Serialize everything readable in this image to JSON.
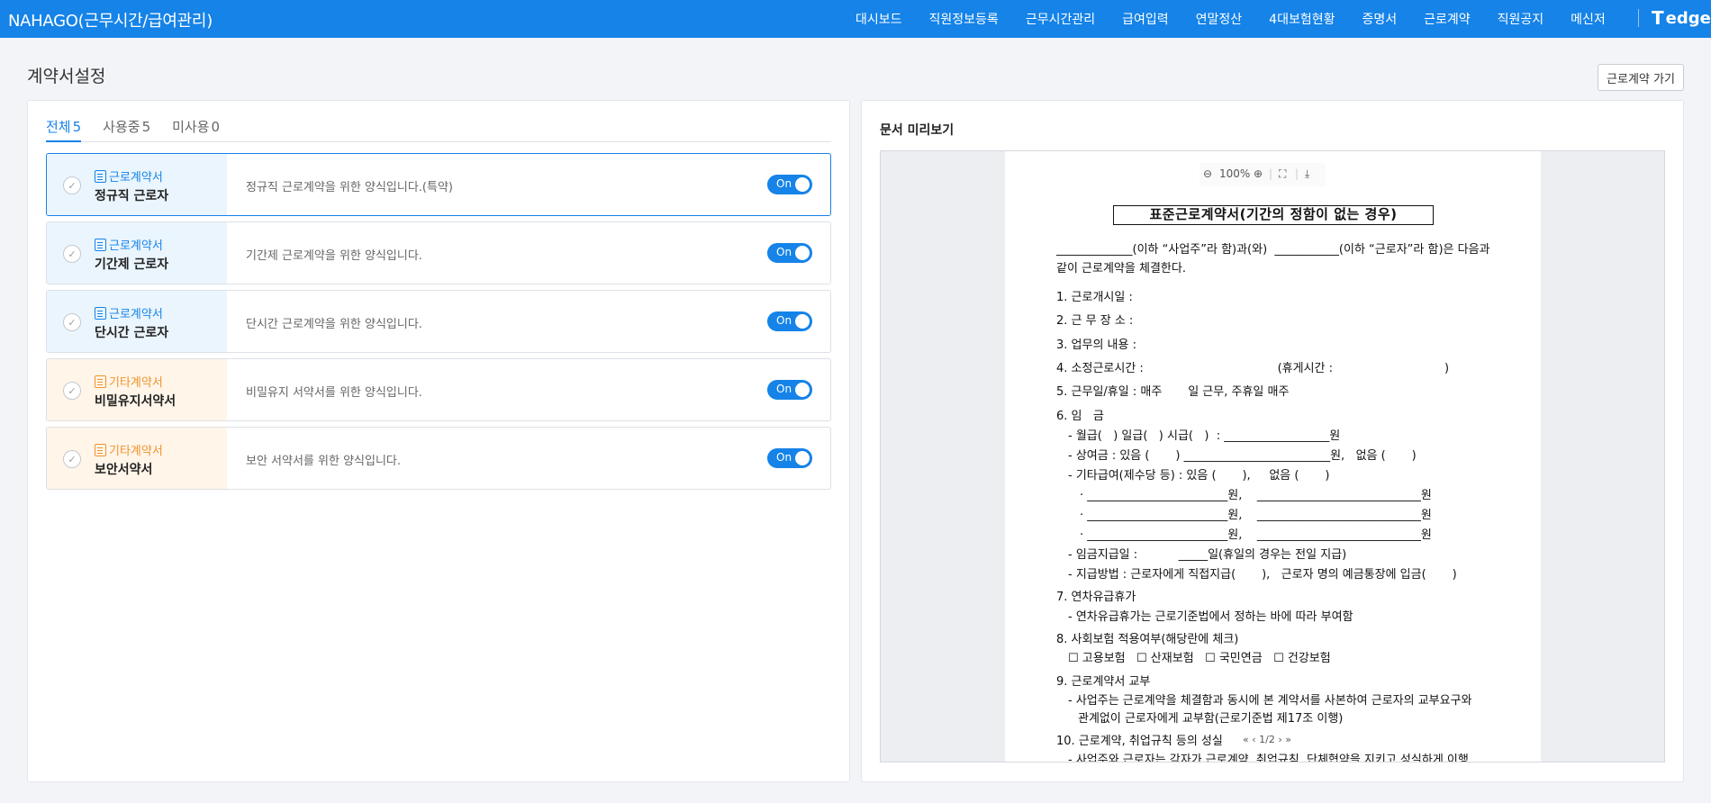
{
  "app": {
    "title": "NAHAGO(근무시간/급여관리)",
    "nav": [
      "대시보드",
      "직원정보등록",
      "근무시간관리",
      "급여입력",
      "연말정산",
      "4대보험현황",
      "증명서",
      "근로계약",
      "직원공지",
      "메신저"
    ],
    "logo_mark": "T",
    "logo_text": "edge"
  },
  "page": {
    "title": "계약서설정",
    "goto_button": "근로계약 가기"
  },
  "tabs": [
    {
      "label": "전체",
      "count": "5",
      "active": true
    },
    {
      "label": "사용중",
      "count": "5",
      "active": false
    },
    {
      "label": "미사용",
      "count": "0",
      "active": false
    }
  ],
  "templates": [
    {
      "category": "근로계약서",
      "name": "정규직 근로자",
      "desc": "정규직 근로계약을 위한 양식입니다.(특약)",
      "toggle": "On",
      "selected": true,
      "accent": "blue"
    },
    {
      "category": "근로계약서",
      "name": "기간제 근로자",
      "desc": "기간제 근로계약을 위한 양식입니다.",
      "toggle": "On",
      "selected": false,
      "accent": "blue"
    },
    {
      "category": "근로계약서",
      "name": "단시간 근로자",
      "desc": "단시간 근로계약을 위한 양식입니다.",
      "toggle": "On",
      "selected": false,
      "accent": "blue"
    },
    {
      "category": "기타계약서",
      "name": "비밀유지서약서",
      "desc": "비밀유지 서약서를 위한 양식입니다.",
      "toggle": "On",
      "selected": false,
      "accent": "orange"
    },
    {
      "category": "기타계약서",
      "name": "보안서약서",
      "desc": "보안 서약서를 위한 양식입니다.",
      "toggle": "On",
      "selected": false,
      "accent": "orange"
    }
  ],
  "colors": {
    "primary": "#1583e8",
    "orange": "#f0932b"
  },
  "preview": {
    "title": "문서 미리보기",
    "zoom": "100%",
    "page_indicator": "1/2",
    "doc_title": "표준근로계약서(기간의 정함이 없는 경우)",
    "lines": [
      "_____________(이하 “사업주”라 함)과(와)  ___________(이하 “근로자”라 함)은 다음과",
      "같이 근로계약을 체결한다.",
      "1. 근로개시일 :",
      "2. 근 무 장 소 :",
      "3. 업무의 내용 :",
      "4. 소정근로시간 :                                    (휴게시간 :                              )",
      "5. 근무일/휴일 : 매주       일 근무, 주휴일 매주",
      "6. 임   금",
      "- 월급(   ) 일급(   ) 시급(   )  : __________________원",
      "- 상여금 : 있음 (       ) _________________________원,   없음 (       )",
      "- 기타급여(제수당 등) : 있음 (       ),     없음 (       )",
      "· ________________________원,    ____________________________원",
      "· ________________________원,    ____________________________원",
      "· ________________________원,    ____________________________원",
      "- 임금지급일 :           _____일(휴일의 경우는 전일 지급)",
      "- 지급방법 : 근로자에게 직접지급(       ),   근로자 명의 예금통장에 입금(       )",
      "7. 연차유급휴가",
      "- 연차유급휴가는 근로기준법에서 정하는 바에 따라 부여함",
      "8. 사회보험 적용여부(해당란에 체크)",
      "☐ 고용보험   ☐ 산재보험   ☐ 국민연금   ☐ 건강보험",
      "9. 근로계약서 교부",
      "- 사업주는 근로계약을 체결함과 동시에 본 계약서를 사본하여 근로자의 교부요구와",
      "관계없이 근로자에게 교부함(근로기준법 제17조 이행)",
      "10. 근로계약, 취업규칙 등의 성실",
      "- 사업주와 근로자는 각자가 근로계약, 취업규칙, 단체협약을 지키고 성실하게 이행"
    ]
  }
}
